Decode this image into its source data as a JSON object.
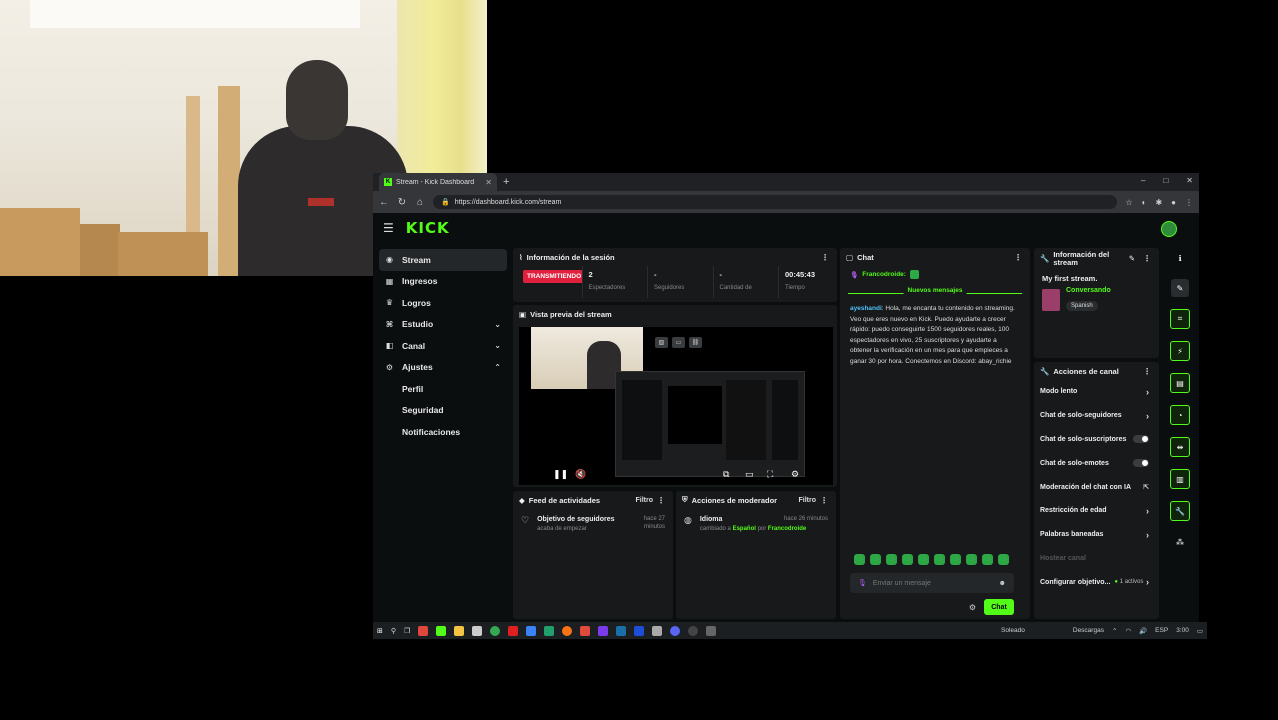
{
  "browser": {
    "tab_title": "Stream - Kick Dashboard",
    "favicon": "K",
    "url": "https://dashboard.kick.com/stream",
    "window_controls": [
      "–",
      "□",
      "✕"
    ]
  },
  "header": {
    "logo": "KICK"
  },
  "sidebar": {
    "items": [
      {
        "label": "Stream",
        "icon": "((•))"
      },
      {
        "label": "Ingresos",
        "icon": "▦"
      },
      {
        "label": "Logros",
        "icon": "🏆"
      },
      {
        "label": "Estudio",
        "icon": "⌘"
      },
      {
        "label": "Canal",
        "icon": "◧"
      },
      {
        "label": "Ajustes",
        "icon": "⚙"
      }
    ],
    "subitems": [
      "Perfil",
      "Seguridad",
      "Notificaciones"
    ]
  },
  "session": {
    "title": "Información de la sesión",
    "status": "TRANSMITIENDO",
    "stats": [
      {
        "value": "2",
        "label": "Espectadores"
      },
      {
        "value": "-",
        "label": "Seguidores"
      },
      {
        "value": "-",
        "label": "Cantidad de"
      },
      {
        "value": "00:45:43",
        "label": "Tiempo"
      }
    ]
  },
  "preview": {
    "title": "Vista previa del stream"
  },
  "feed": {
    "title": "Feed de actividades",
    "filter": "Filtro",
    "item_title": "Objetivo de seguidores",
    "item_sub": "acaba de empezar",
    "item_time": "hace 27 minutos"
  },
  "mod": {
    "title": "Acciones de moderador",
    "filter": "Filtro",
    "item_title": "Idioma",
    "item_time": "hace 26 minutos",
    "changed": "cambiado a",
    "lang": "Español",
    "by": "por",
    "user": "Francodroide"
  },
  "chat": {
    "title": "Chat",
    "pinned_user": "Francodroide:",
    "new_messages": "Nuevos mensajes",
    "msg_user": "ayeshandi",
    "msg_text": ": Hola, me encanta tu contenido en streaming. Veo que eres nuevo en Kick. Puedo ayudarte a crecer rápido: puedo conseguirte 1500 seguidores reales, 100 espectadores en vivo, 25 suscriptores y ayudarte a obtener la verificación en un mes para que empieces a ganar 30 por hora. Conectemos en Discord: abay_richie",
    "input_placeholder": "Enviar un mensaje",
    "send_label": "Chat"
  },
  "stream_info": {
    "title": "Información del stream",
    "stream_title": "My first stream.",
    "category": "Conversando",
    "tag": "Spanish"
  },
  "channel_actions": {
    "title": "Acciones de canal",
    "items": [
      "Modo lento",
      "Chat de solo-seguidores",
      "Chat de solo-suscriptores",
      "Chat de solo-emotes",
      "Moderación del chat con IA",
      "Restricción de edad",
      "Palabras baneadas",
      "Hostear canal",
      "Configurar objetivo..."
    ],
    "active_count": "1 activos"
  },
  "taskbar": {
    "weather": "Soleado",
    "right_text": "Descargas",
    "lang": "ESP",
    "time": "3:00"
  },
  "colors": {
    "accent": "#53fc18",
    "live": "#e0203c",
    "bg": "#0b0e0f",
    "panel": "#17191b"
  }
}
